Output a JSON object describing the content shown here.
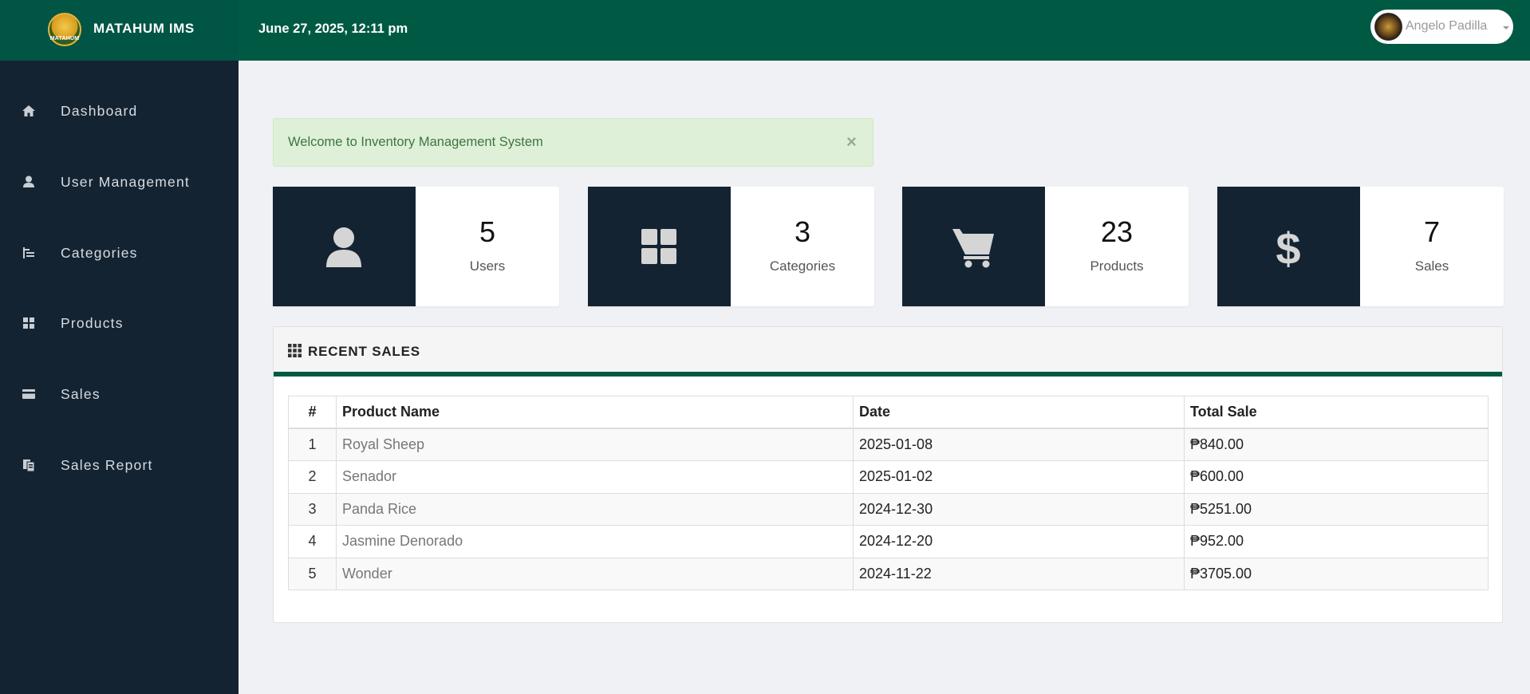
{
  "brand": {
    "logo_text": "MATAHUM",
    "name": "MATAHUM IMS"
  },
  "header": {
    "datetime": "June 27, 2025, 12:11 pm",
    "user_name": "Angelo Padilla"
  },
  "sidebar": {
    "items": [
      {
        "label": "Dashboard",
        "icon": "home-icon"
      },
      {
        "label": "User Management",
        "icon": "user-icon"
      },
      {
        "label": "Categories",
        "icon": "indent-list-icon"
      },
      {
        "label": "Products",
        "icon": "grid-icon"
      },
      {
        "label": "Sales",
        "icon": "credit-card-icon"
      },
      {
        "label": "Sales Report",
        "icon": "duplicate-icon"
      }
    ]
  },
  "alert": {
    "message": "Welcome to Inventory Management System",
    "close": "×"
  },
  "stats": [
    {
      "value": "5",
      "label": "Users",
      "icon": "user-icon"
    },
    {
      "value": "3",
      "label": "Categories",
      "icon": "grid-icon"
    },
    {
      "value": "23",
      "label": "Products",
      "icon": "cart-icon"
    },
    {
      "value": "7",
      "label": "Sales",
      "icon": "dollar-icon"
    }
  ],
  "recent_sales": {
    "title": "RECENT SALES",
    "columns": [
      "#",
      "Product Name",
      "Date",
      "Total Sale"
    ],
    "rows": [
      {
        "num": "1",
        "name": "Royal Sheep",
        "date": "2025-01-08",
        "total": "₱840.00"
      },
      {
        "num": "2",
        "name": "Senador",
        "date": "2025-01-02",
        "total": "₱600.00"
      },
      {
        "num": "3",
        "name": "Panda Rice",
        "date": "2024-12-30",
        "total": "₱5251.00"
      },
      {
        "num": "4",
        "name": "Jasmine Denorado",
        "date": "2024-12-20",
        "total": "₱952.00"
      },
      {
        "num": "5",
        "name": "Wonder",
        "date": "2024-11-22",
        "total": "₱3705.00"
      }
    ]
  },
  "colors": {
    "header": "#005a43",
    "sidebar": "#142332",
    "accent": "#005a43",
    "alert_bg": "#dff0d8"
  }
}
